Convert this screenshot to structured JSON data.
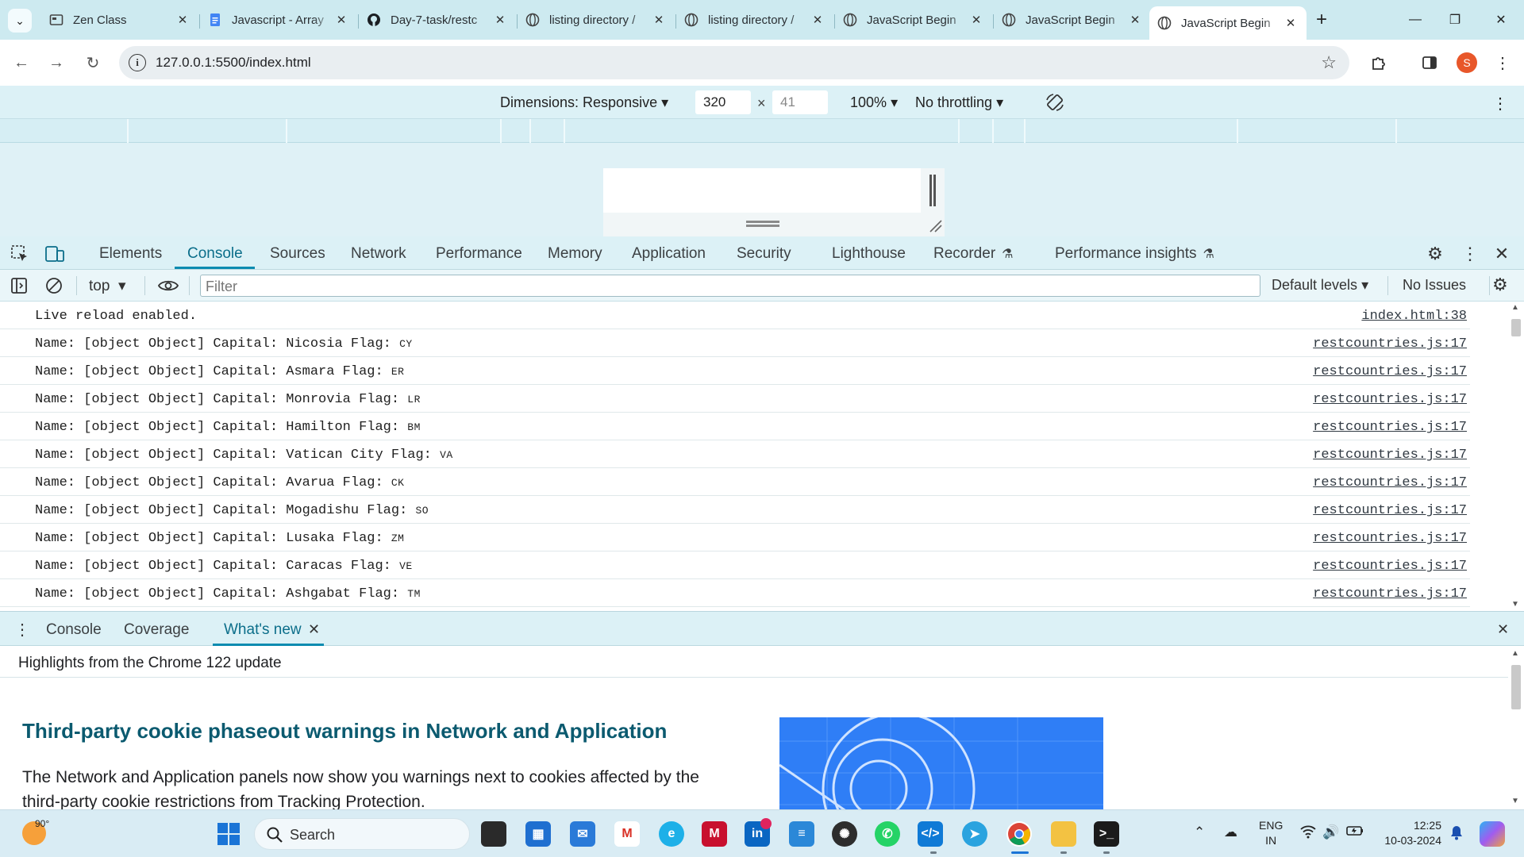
{
  "browser": {
    "tabs": [
      {
        "title": "Zen Class",
        "favicon": "zen-class-icon"
      },
      {
        "title": "Javascript - Array",
        "favicon": "google-docs-icon"
      },
      {
        "title": "Day-7-task/restc",
        "favicon": "github-icon"
      },
      {
        "title": "listing directory /",
        "favicon": "globe-icon"
      },
      {
        "title": "listing directory /",
        "favicon": "globe-icon"
      },
      {
        "title": "JavaScript Begin",
        "favicon": "globe-icon"
      },
      {
        "title": "JavaScript Begin",
        "favicon": "globe-icon"
      },
      {
        "title": "JavaScript Begin",
        "favicon": "globe-icon",
        "active": true
      }
    ],
    "url": "127.0.0.1:5500/index.html",
    "profile_initial": "S"
  },
  "device_toolbar": {
    "dimensions_label": "Dimensions: Responsive",
    "width": "320",
    "height": "41",
    "times": "×",
    "zoom": "100%",
    "throttling": "No throttling"
  },
  "devtools": {
    "tabs": [
      "Elements",
      "Console",
      "Sources",
      "Network",
      "Performance",
      "Memory",
      "Application",
      "Security",
      "Lighthouse",
      "Recorder",
      "Performance insights"
    ],
    "active_tab": "Console",
    "console_toolbar": {
      "context": "top",
      "filter_placeholder": "Filter",
      "levels": "Default levels",
      "issues": "No Issues"
    },
    "console_rows": [
      {
        "message": "Live reload enabled.",
        "flag": "",
        "source": "index.html:38"
      },
      {
        "message": "Name: [object Object] Capital: Nicosia Flag: ",
        "flag": "CY",
        "source": "restcountries.js:17"
      },
      {
        "message": "Name: [object Object] Capital: Asmara Flag: ",
        "flag": "ER",
        "source": "restcountries.js:17"
      },
      {
        "message": "Name: [object Object] Capital: Monrovia Flag: ",
        "flag": "LR",
        "source": "restcountries.js:17"
      },
      {
        "message": "Name: [object Object] Capital: Hamilton Flag: ",
        "flag": "BM",
        "source": "restcountries.js:17"
      },
      {
        "message": "Name: [object Object] Capital: Vatican City Flag: ",
        "flag": "VA",
        "source": "restcountries.js:17"
      },
      {
        "message": "Name: [object Object] Capital: Avarua Flag: ",
        "flag": "CK",
        "source": "restcountries.js:17"
      },
      {
        "message": "Name: [object Object] Capital: Mogadishu Flag: ",
        "flag": "SO",
        "source": "restcountries.js:17"
      },
      {
        "message": "Name: [object Object] Capital: Lusaka Flag: ",
        "flag": "ZM",
        "source": "restcountries.js:17"
      },
      {
        "message": "Name: [object Object] Capital: Caracas Flag: ",
        "flag": "VE",
        "source": "restcountries.js:17"
      },
      {
        "message": "Name: [object Object] Capital: Ashgabat Flag: ",
        "flag": "TM",
        "source": "restcountries.js:17"
      }
    ],
    "drawer": {
      "tabs": [
        "Console",
        "Coverage",
        "What's new"
      ],
      "active_tab": "What's new",
      "highlights": "Highlights from the Chrome 122 update",
      "article_title": "Third-party cookie phaseout warnings in Network and Application",
      "article_body": "The Network and Application panels now show you warnings next to cookies affected by the third-party cookie restrictions from Tracking Protection."
    }
  },
  "taskbar": {
    "weather_temp": "90°",
    "search_label": "Search",
    "lang_line1": "ENG",
    "lang_line2": "IN",
    "time": "12:25",
    "date": "10-03-2024"
  },
  "colors": {
    "accent": "#0b8bb0",
    "tab_strip": "#cdeaf0",
    "devtools_bg": "#dcf1f6",
    "heading": "#0b5a6f"
  }
}
